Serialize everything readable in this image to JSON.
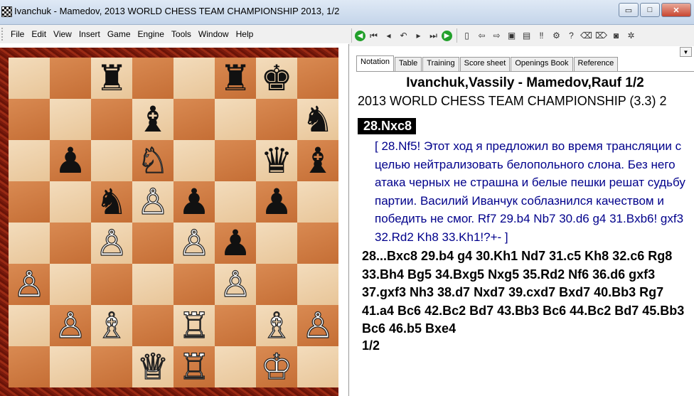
{
  "window": {
    "title": "Ivanchuk - Mamedov, 2013 WORLD CHESS TEAM CHAMPIONSHIP 2013, 1/2",
    "min_label": "▭",
    "max_label": "□",
    "close_label": "✕"
  },
  "menu": [
    "File",
    "Edit",
    "View",
    "Insert",
    "Game",
    "Engine",
    "Tools",
    "Window",
    "Help"
  ],
  "toolbar_icons": [
    "back-icon",
    "first-move-icon",
    "prev-move-icon",
    "undo-icon",
    "next-move-icon",
    "last-move-icon",
    "forward-icon",
    "new-game-icon",
    "prev-game-icon",
    "next-game-icon",
    "save-icon",
    "save-as-icon",
    "analyze-icon",
    "engine-icon",
    "options-icon",
    "eraser-icon",
    "eraser2-icon",
    "camera-icon",
    "gear-icon"
  ],
  "board": [
    [
      "",
      "",
      "♜",
      "",
      "",
      "♜",
      "♚",
      ""
    ],
    [
      "",
      "",
      "",
      "♝",
      "",
      "",
      "",
      "♞"
    ],
    [
      "",
      "♟",
      "",
      "♘",
      "",
      "",
      "♛",
      "♝"
    ],
    [
      "",
      "",
      "♞",
      "♙",
      "♟",
      "",
      "♟",
      ""
    ],
    [
      "",
      "",
      "♙",
      "",
      "♙",
      "♟",
      "",
      ""
    ],
    [
      "♙",
      "",
      "",
      "",
      "",
      "♙",
      "",
      ""
    ],
    [
      "",
      "♙",
      "♗",
      "",
      "♖",
      "",
      "♗",
      "♙"
    ],
    [
      "",
      "",
      "",
      "♕",
      "♖",
      "",
      "♔",
      ""
    ]
  ],
  "tabs": [
    "Notation",
    "Table",
    "Training",
    "Score sheet",
    "Openings Book",
    "Reference"
  ],
  "game": {
    "header": "Ivanchuk,Vassily - Mamedov,Rauf   1/2",
    "event": "2013 WORLD CHESS TEAM CHAMPIONSHIP (3.3) 2",
    "current_move": "28.Nxc8",
    "comment": "[ 28.Nf5! Этот ход я предложил во время трансляции с целью нейтрализовать белопольного слона. Без него атака черных не страшна и белые пешки решат судьбу партии. Василий Иванчук соблазнился качеством и победить не смог.  Rf7  29.b4  Nb7  30.d6  g4  31.Bxb6!  gxf3  32.Rd2  Kh8  33.Kh1!?+- ]",
    "moves": "28...Bxc8  29.b4  g4  30.Kh1  Nd7  31.c5  Kh8  32.c6  Rg8  33.Bh4  Bg5  34.Bxg5  Nxg5  35.Rd2  Nf6  36.d6  gxf3  37.gxf3  Nh3  38.d7  Nxd7  39.cxd7  Bxd7  40.Bb3  Rg7  41.a4  Bc6  42.Bc2  Bd7  43.Bb3  Bc6  44.Bc2  Bd7  45.Bb3  Bc6  46.b5  Bxe4",
    "result": "1/2"
  }
}
